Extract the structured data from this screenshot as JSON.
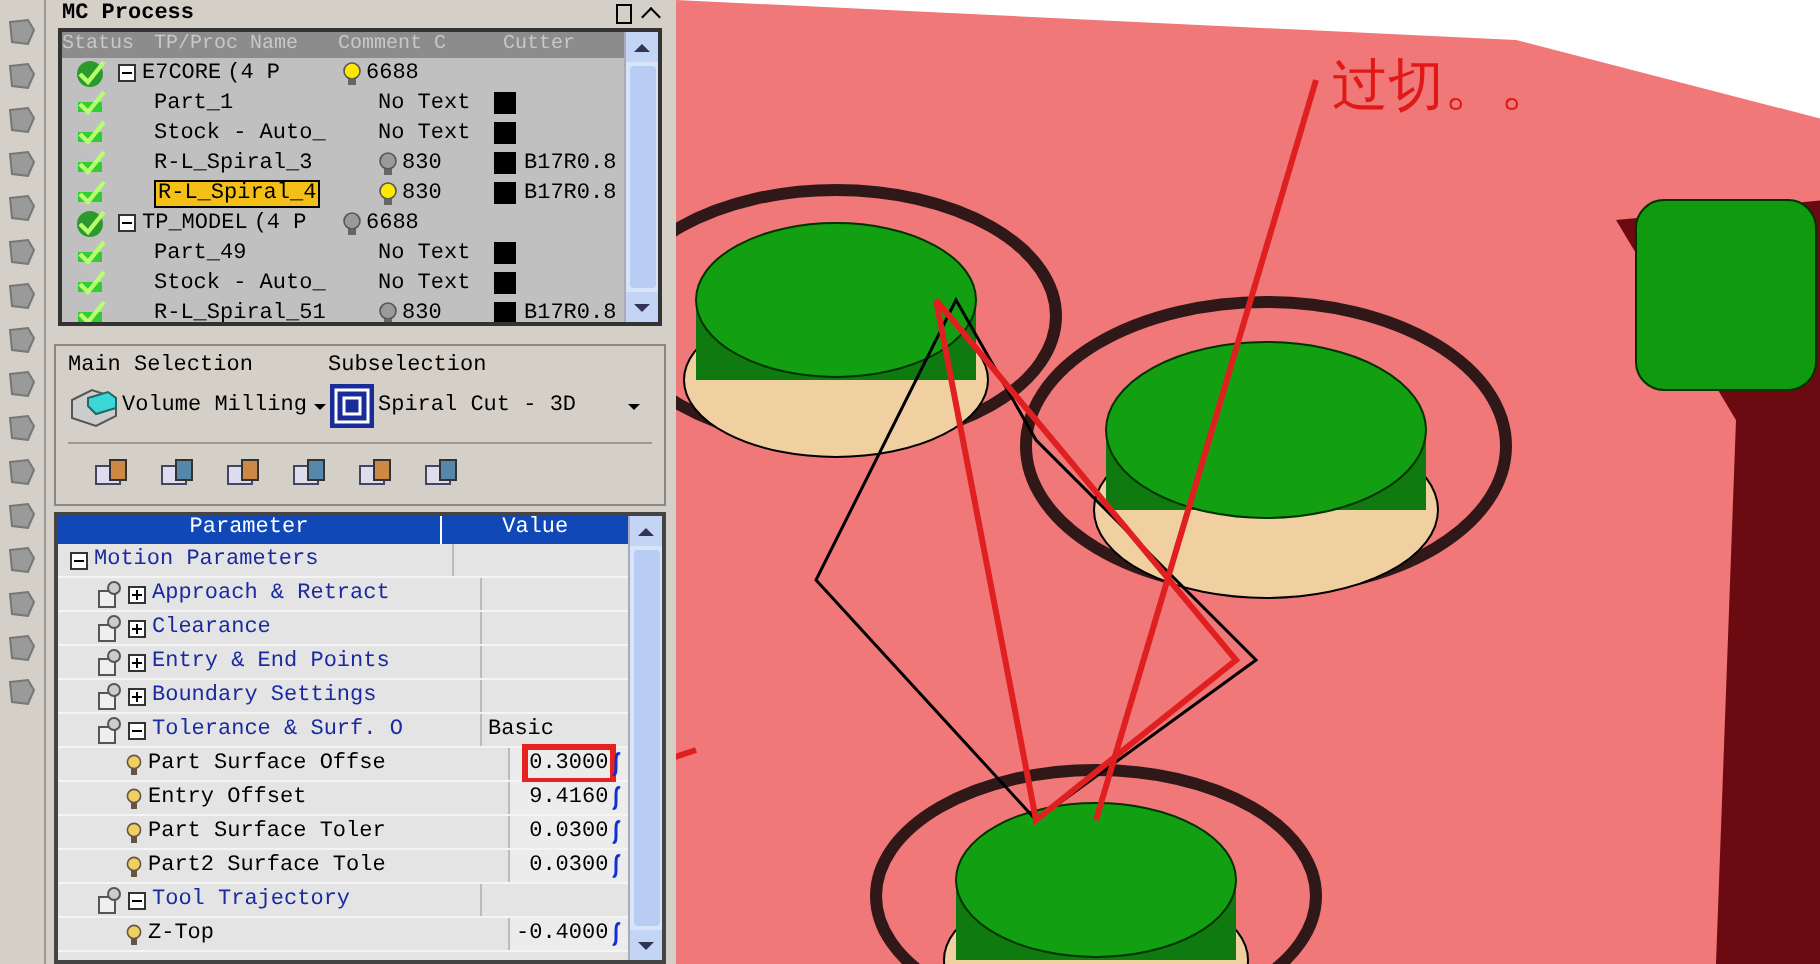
{
  "window": {
    "title": "MC Process"
  },
  "process_tree": {
    "columns": [
      "Status",
      "TP/Proc Name",
      "Comment C",
      "Cutter"
    ],
    "rows": [
      {
        "name": "E7CORE",
        "count": "(4 P",
        "lit": true,
        "comment": "6688",
        "selected": false,
        "expanded": true,
        "children": [
          {
            "name": "Part_1",
            "comment": "No Text",
            "selected": false
          },
          {
            "name": "Stock - Auto_",
            "comment": "No Text",
            "selected": false
          },
          {
            "name": "R-L_Spiral_3",
            "lit": false,
            "comment": "830",
            "cutter": "B17R0.8",
            "selected": false
          },
          {
            "name": "R-L_Spiral_4",
            "lit": true,
            "comment": "830",
            "cutter": "B17R0.8",
            "selected": true
          }
        ]
      },
      {
        "name": "TP_MODEL",
        "count": "(4 P",
        "lit": false,
        "comment": "6688",
        "selected": false,
        "expanded": true,
        "children": [
          {
            "name": "Part_49",
            "comment": "No Text",
            "selected": false
          },
          {
            "name": "Stock - Auto_",
            "comment": "No Text",
            "selected": false
          },
          {
            "name": "R-L_Spiral_51",
            "lit": false,
            "comment": "830",
            "cutter": "B17R0.8",
            "selected": false
          }
        ]
      }
    ]
  },
  "selection": {
    "main_label": "Main Selection",
    "main_value": "Volume Milling",
    "sub_label": "Subselection",
    "sub_value": "Spiral Cut - 3D"
  },
  "parameters": {
    "columns": [
      "Parameter",
      "Value"
    ],
    "rows": [
      {
        "name": "Motion Parameters",
        "expanded": true,
        "children": [
          {
            "name": "Approach & Retract",
            "expanded": false
          },
          {
            "name": "Clearance",
            "expanded": false
          },
          {
            "name": "Entry & End Points",
            "expanded": false
          },
          {
            "name": "Boundary Settings",
            "expanded": false
          },
          {
            "name": "Tolerance & Surf. O",
            "value": "Basic",
            "expanded": true,
            "children": [
              {
                "name": "Part Surface Offse",
                "value": "0.3000",
                "highlighted": true
              },
              {
                "name": "Entry Offset",
                "value": "9.4160",
                "highlighted": false
              },
              {
                "name": "Part Surface Toler",
                "value": "0.0300",
                "highlighted": false
              },
              {
                "name": "Part2 Surface Tole",
                "value": "0.0300",
                "highlighted": false
              }
            ]
          },
          {
            "name": "Tool Trajectory",
            "expanded": true,
            "children": [
              {
                "name": "Z-Top",
                "value": "-0.4000",
                "highlighted": false
              }
            ]
          }
        ]
      }
    ]
  },
  "viewport": {
    "annotation": "过切。。"
  }
}
